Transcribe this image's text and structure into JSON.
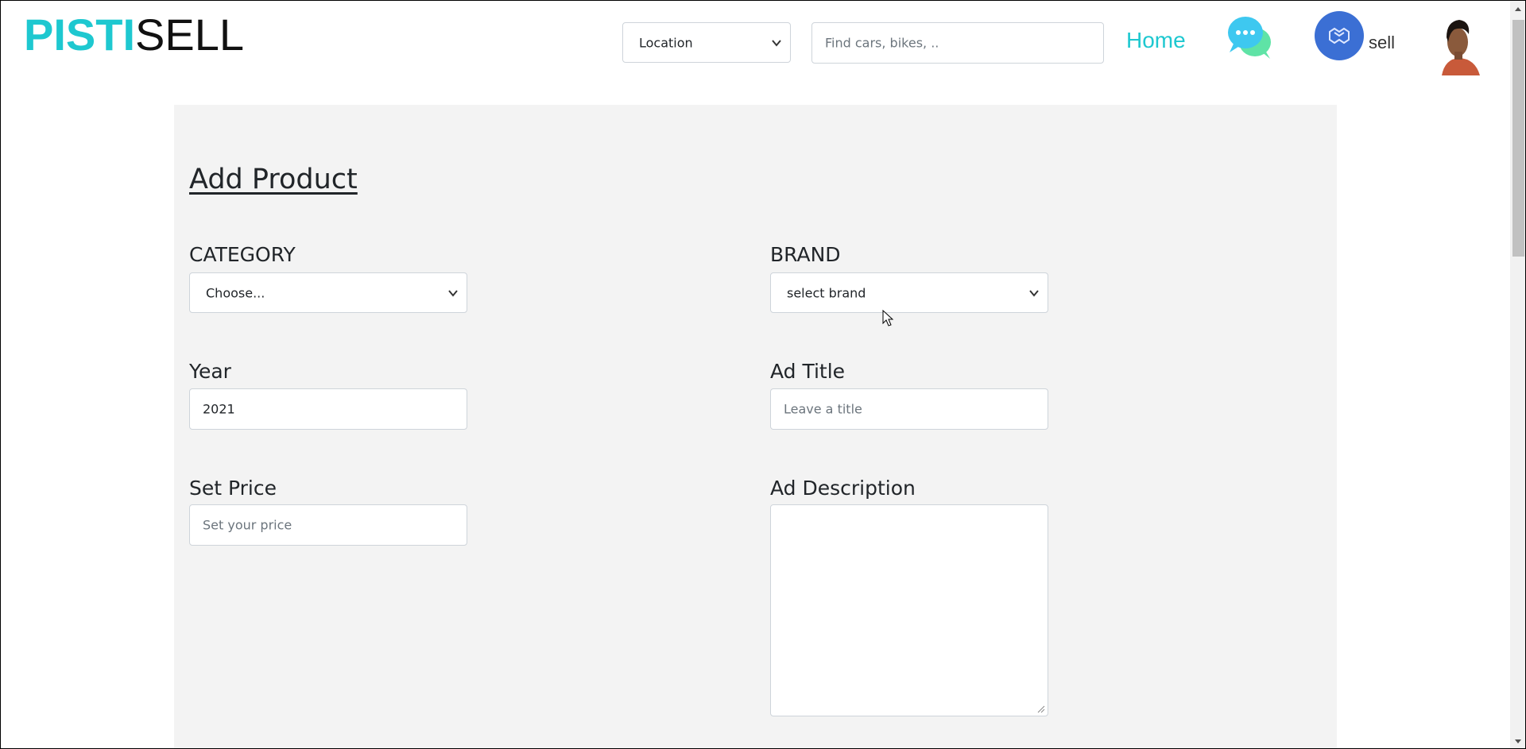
{
  "header": {
    "logo_part1": "PISTI",
    "logo_part2": "SELL",
    "location_select": "Location",
    "search_placeholder": "Find cars, bikes, ..",
    "home_link": "Home",
    "sell_label": "sell"
  },
  "form": {
    "title": "Add Product",
    "category_label": "CATEGORY",
    "category_value": "Choose...",
    "brand_label": "BRAND",
    "brand_value": "select brand",
    "year_label": "Year",
    "year_value": "2021",
    "ad_title_label": "Ad Title",
    "ad_title_placeholder": "Leave a title",
    "price_label": "Set Price",
    "price_placeholder": "Set your price",
    "description_label": "Ad Description"
  },
  "icons": {
    "chat": "chat-bubbles-icon",
    "sell": "sell-icon",
    "avatar": "user-avatar",
    "select_chevron": "chevron-down-icon"
  },
  "colors": {
    "brand": "#1ec8d0",
    "panel": "#f3f3f3",
    "sell_button": "#3b6fd4"
  }
}
